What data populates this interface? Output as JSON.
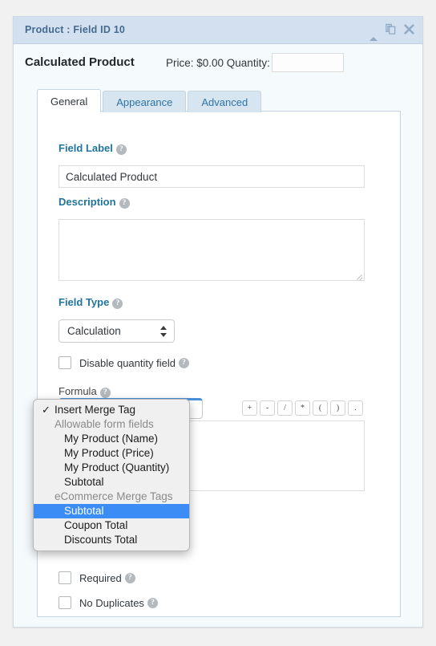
{
  "panel": {
    "title": "Product : Field ID 10",
    "header_icons": [
      {
        "name": "collapse-icon",
        "glyph": "▲"
      },
      {
        "name": "duplicate-icon",
        "glyph": "❐"
      },
      {
        "name": "close-icon",
        "glyph": "✖"
      }
    ]
  },
  "field_header": {
    "field_name": "Calculated Product",
    "price_quantity_text": "Price: $0.00 Quantity:",
    "quantity_value": ""
  },
  "tabs": [
    {
      "label": "General",
      "active": true
    },
    {
      "label": "Appearance",
      "active": false
    },
    {
      "label": "Advanced",
      "active": false
    }
  ],
  "general": {
    "field_label": {
      "label": "Field Label",
      "value": "Calculated Product",
      "help": "?"
    },
    "description": {
      "label": "Description",
      "value": "",
      "help": "?"
    },
    "field_type": {
      "label": "Field Type",
      "value": "Calculation",
      "help": "?"
    },
    "disable_quantity": {
      "label": "Disable quantity field",
      "checked": false,
      "help": "?"
    },
    "formula": {
      "label": "Formula",
      "value": "",
      "help": "?",
      "merge_tag_button": "Insert Merge Tag",
      "operators": [
        "+",
        "-",
        "/",
        "*",
        "(",
        ")",
        "."
      ]
    },
    "required": {
      "label": "Required",
      "checked": false,
      "help": "?"
    },
    "no_duplicates": {
      "label": "No Duplicates",
      "checked": false,
      "help": "?"
    }
  },
  "dropdown": {
    "items": [
      {
        "label": "Insert Merge Tag",
        "type": "checked"
      },
      {
        "label": "Allowable form fields",
        "type": "group"
      },
      {
        "label": "My Product (Name)",
        "type": "item"
      },
      {
        "label": "My Product (Price)",
        "type": "item"
      },
      {
        "label": "My Product (Quantity)",
        "type": "item"
      },
      {
        "label": "Subtotal",
        "type": "item"
      },
      {
        "label": "eCommerce Merge Tags",
        "type": "group"
      },
      {
        "label": "Subtotal",
        "type": "selected"
      },
      {
        "label": "Coupon Total",
        "type": "item"
      },
      {
        "label": "Discounts Total",
        "type": "item"
      }
    ],
    "highlight_color": "#3b8cf5"
  },
  "colors": {
    "page_bg": "#f1f1f1",
    "panel_header_bg": "#d3e0ef",
    "panel_body_bg": "#f5fafd",
    "label_blue": "#21759b",
    "tab_inactive_bg": "#d7e5f0"
  }
}
